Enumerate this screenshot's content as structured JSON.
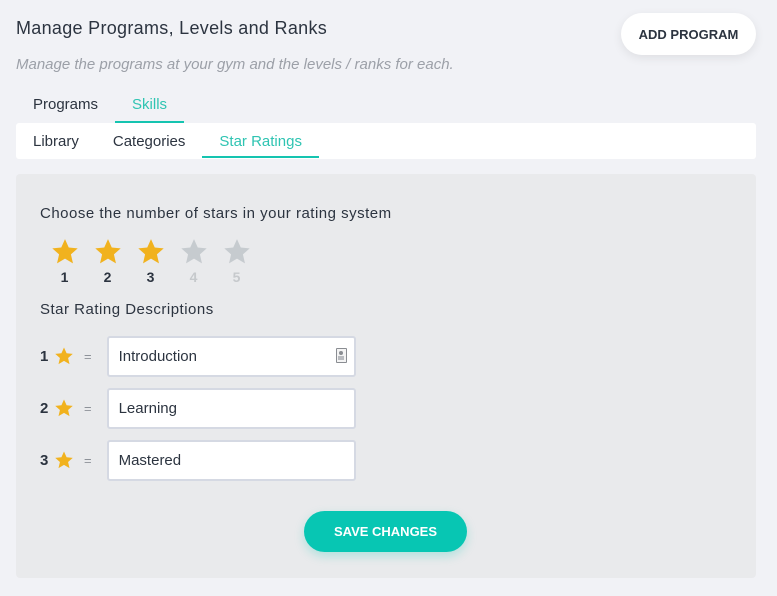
{
  "header": {
    "title": "Manage Programs, Levels and Ranks",
    "subtitle": "Manage the programs at your gym and the levels / ranks for each.",
    "add_program_label": "ADD PROGRAM"
  },
  "tabs": [
    {
      "label": "Programs",
      "active": false
    },
    {
      "label": "Skills",
      "active": true
    }
  ],
  "sub_tabs": [
    {
      "label": "Library",
      "active": false
    },
    {
      "label": "Categories",
      "active": false
    },
    {
      "label": "Star Ratings",
      "active": true
    }
  ],
  "star_ratings": {
    "choose_heading": "Choose the number of stars in your rating system",
    "selected_count": 3,
    "max_stars": 5,
    "options": [
      {
        "label": "1",
        "selected": true
      },
      {
        "label": "2",
        "selected": true
      },
      {
        "label": "3",
        "selected": true
      },
      {
        "label": "4",
        "selected": false
      },
      {
        "label": "5",
        "selected": false
      }
    ],
    "descriptions_heading": "Star Rating Descriptions",
    "equals_sign": "=",
    "descriptions": [
      {
        "number": "1",
        "value": "Introduction",
        "icon": "contact-card-icon"
      },
      {
        "number": "2",
        "value": "Learning"
      },
      {
        "number": "3",
        "value": "Mastered"
      }
    ]
  },
  "colors": {
    "accent": "#07c6b3",
    "star_on": "#f1b21e",
    "star_off": "#c6cbcf"
  },
  "save_label": "SAVE CHANGES"
}
